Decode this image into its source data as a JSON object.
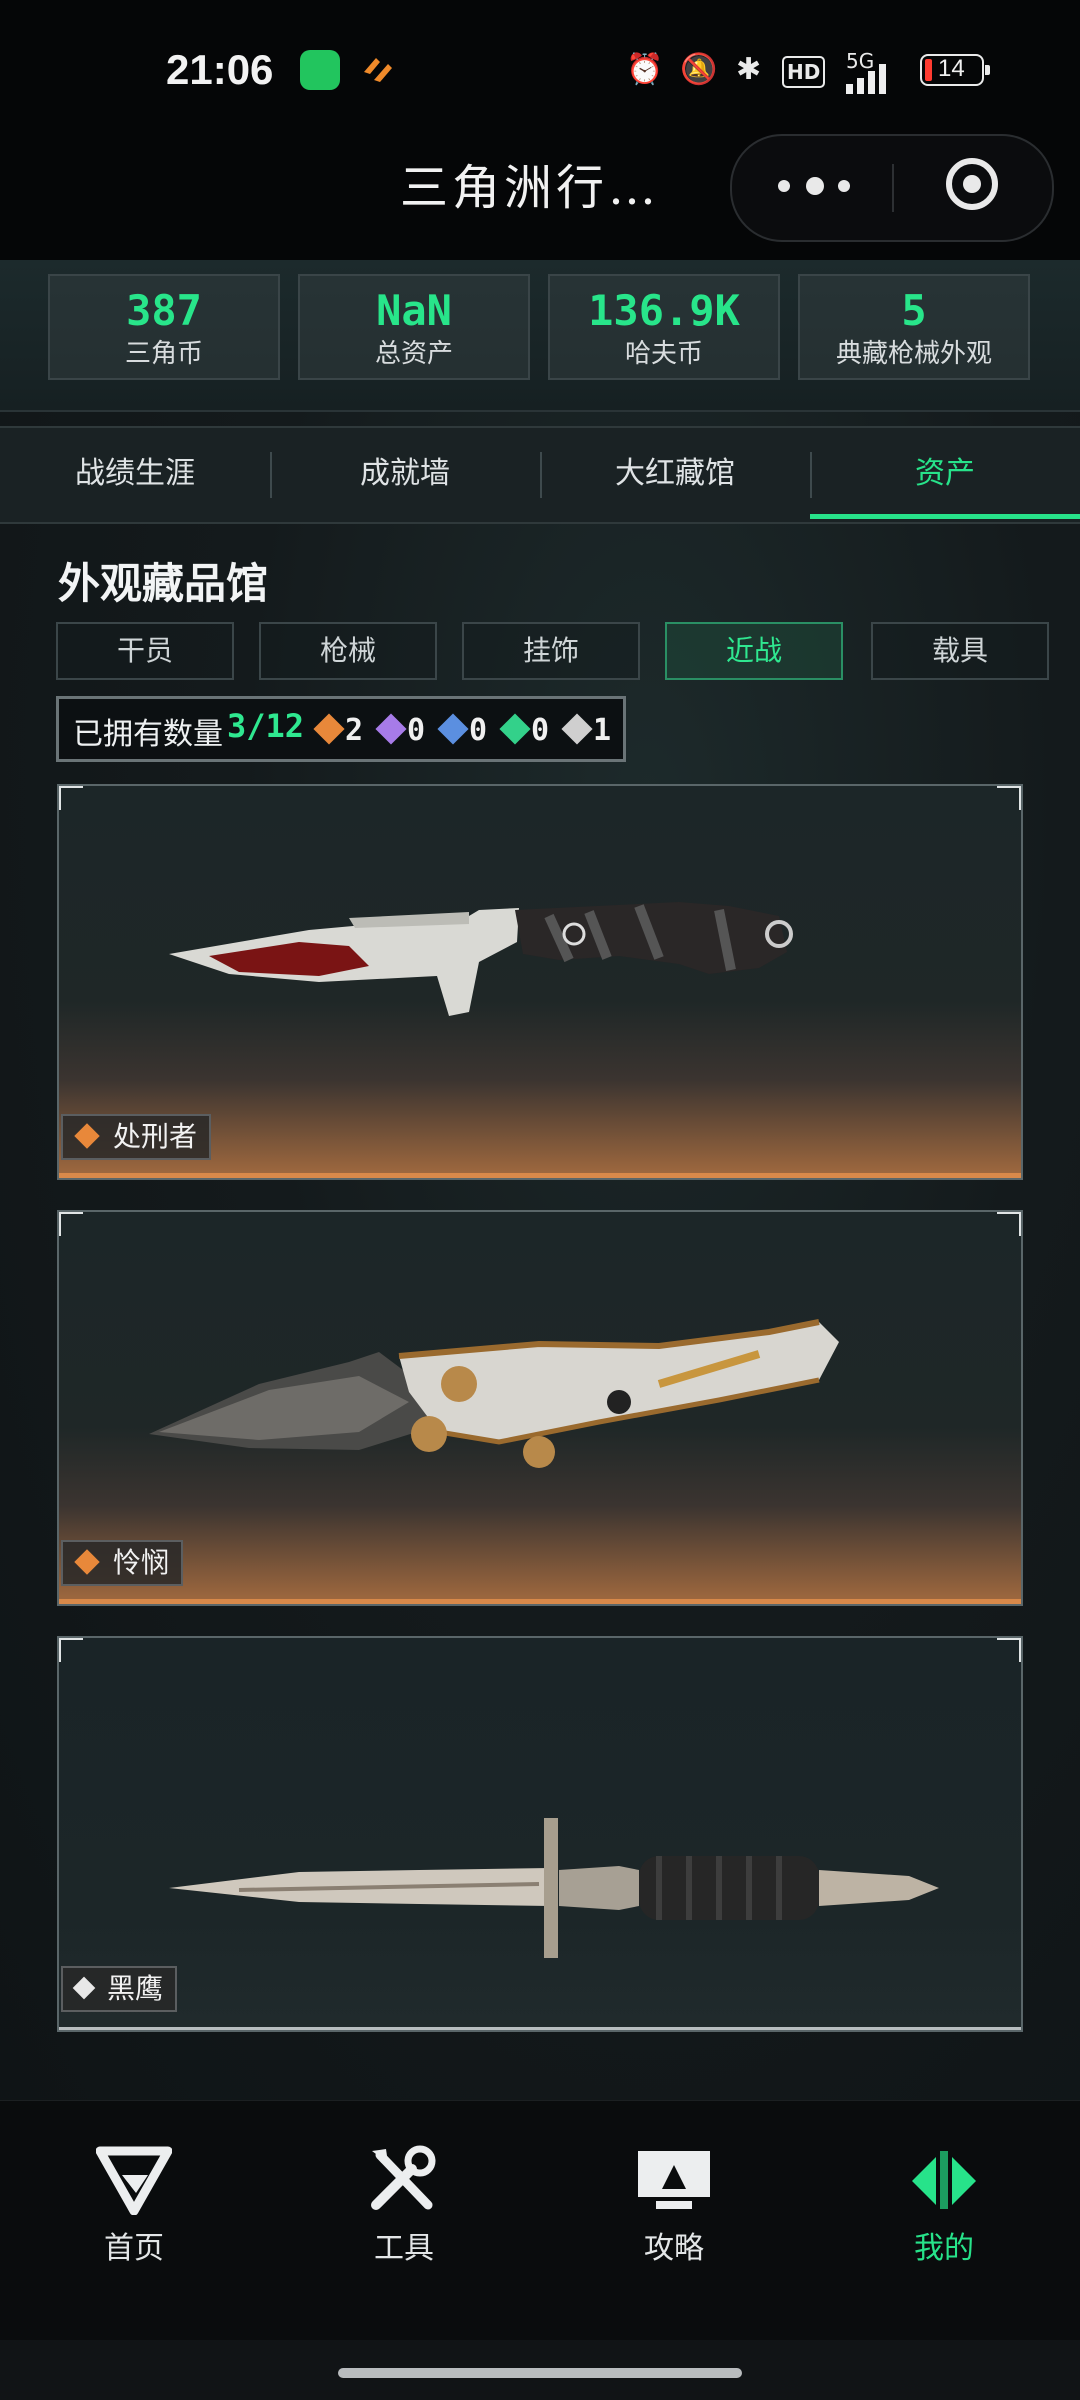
{
  "status_bar": {
    "time": "21:06",
    "network": "5G",
    "battery": "14"
  },
  "header": {
    "title": "三角洲行…"
  },
  "stats": [
    {
      "value": "387",
      "label": "三角币"
    },
    {
      "value": "NaN",
      "label": "总资产"
    },
    {
      "value": "136.9K",
      "label": "哈夫币"
    },
    {
      "value": "5",
      "label": "典藏枪械外观"
    }
  ],
  "tabs": [
    {
      "label": "战绩生涯",
      "active": false
    },
    {
      "label": "成就墙",
      "active": false
    },
    {
      "label": "大红藏馆",
      "active": false
    },
    {
      "label": "资产",
      "active": true
    }
  ],
  "collection": {
    "title": "外观藏品馆",
    "categories": [
      {
        "label": "干员",
        "active": false
      },
      {
        "label": "枪械",
        "active": false
      },
      {
        "label": "挂饰",
        "active": false
      },
      {
        "label": "近战",
        "active": true
      },
      {
        "label": "载具",
        "active": false
      }
    ],
    "owned_label": "已拥有数量",
    "owned_value": "3/12",
    "rarity_counts": [
      {
        "color": "#e8883a",
        "count": "2"
      },
      {
        "color": "#a77be8",
        "count": "0"
      },
      {
        "color": "#5b8fe0",
        "count": "0"
      },
      {
        "color": "#33d18a",
        "count": "0"
      },
      {
        "color": "#cfcfcf",
        "count": "1"
      }
    ],
    "items": [
      {
        "name": "处刑者",
        "rarity_color": "#e8883a",
        "style": "orange"
      },
      {
        "name": "怜悯",
        "rarity_color": "#e8883a",
        "style": "orange"
      },
      {
        "name": "黑鹰",
        "rarity_color": "#e8e8e8",
        "style": "grey"
      }
    ]
  },
  "bottom_nav": [
    {
      "label": "首页",
      "icon": "delta-logo-icon",
      "active": false
    },
    {
      "label": "工具",
      "icon": "tools-icon",
      "active": false
    },
    {
      "label": "攻略",
      "icon": "guide-monitor-icon",
      "active": false
    },
    {
      "label": "我的",
      "icon": "profile-logo-icon",
      "active": true
    }
  ],
  "colors": {
    "accent": "#27e38a",
    "orange_rarity": "#e8883a"
  }
}
